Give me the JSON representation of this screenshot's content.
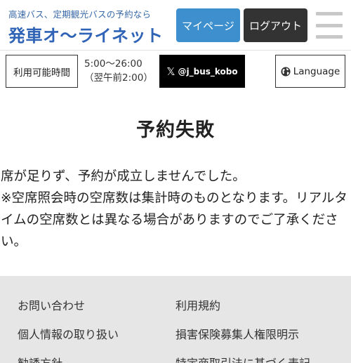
{
  "header": {
    "logo_tagline": "高速バス、定期観光バスの予約なら",
    "logo_title": "発車オ〜ライネット",
    "mypage_label": "マイページ",
    "logout_label": "ログアウト",
    "menu_icon": "hamburger-menu-icon"
  },
  "info_bar": {
    "hours_label": "利用可能時間",
    "hours_line1": "5:00〜26:00",
    "hours_line2": "（翌午前2:00）",
    "x_icon": "x-logo-icon",
    "x_label": "@j_bus_kobo",
    "language_icon": "globe-icon",
    "language_label": "Language"
  },
  "main": {
    "title": "予約失敗",
    "message_line1": "席が足りず、予約が成立しませんでした。",
    "message_line2": "※空席照会時の空席数は集計時のものとなります。リアルタイムの空席数とは異なる場合がありますのでご了承ください。"
  },
  "footer": {
    "links": [
      "お問い合わせ",
      "利用規約",
      "個人情報の取り扱い",
      "損害保険募集人権限明示",
      "勧誘方針",
      "特定商取引法に基づく表記"
    ]
  },
  "colors": {
    "mypage_button": "#3d8fce",
    "logout_button": "#333333",
    "logo": "#2f63b5",
    "footer_background": "#e6e6e6"
  }
}
